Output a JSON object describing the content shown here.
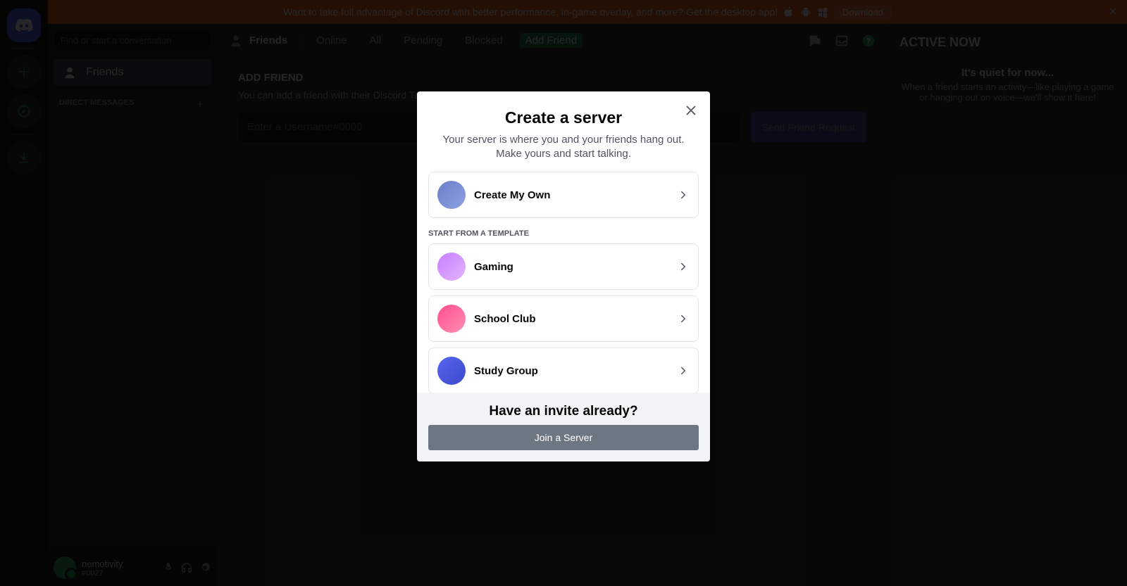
{
  "banner": {
    "text": "Want to take full advantage of Discord with better performance, in-game overlay, and more? Get the desktop app!",
    "download": "Download"
  },
  "sidebar": {
    "search_placeholder": "Find or start a conversation",
    "friends": "Friends",
    "dm_header": "DIRECT MESSAGES"
  },
  "user": {
    "name": "nemotivity",
    "discrim": "#0027"
  },
  "toolbar": {
    "friends": "Friends",
    "tabs": {
      "online": "Online",
      "all": "All",
      "pending": "Pending",
      "blocked": "Blocked",
      "add": "Add Friend"
    }
  },
  "content": {
    "heading": "ADD FRIEND",
    "desc": "You can add a friend with their Discord Tag. It's cAsE sEnSiTiVe!",
    "placeholder": "Enter a Username#0000",
    "send": "Send Friend Request"
  },
  "active": {
    "heading": "ACTIVE NOW",
    "quiet": "It's quiet for now...",
    "desc": "When a friend starts an activity—like playing a game or hanging out on voice—we'll show it here!"
  },
  "modal": {
    "title": "Create a server",
    "subtitle": "Your server is where you and your friends hang out. Make yours and start talking.",
    "create_own": "Create My Own",
    "template_header": "START FROM A TEMPLATE",
    "templates": {
      "gaming": "Gaming",
      "school": "School Club",
      "study": "Study Group"
    },
    "invite_heading": "Have an invite already?",
    "join": "Join a Server"
  }
}
